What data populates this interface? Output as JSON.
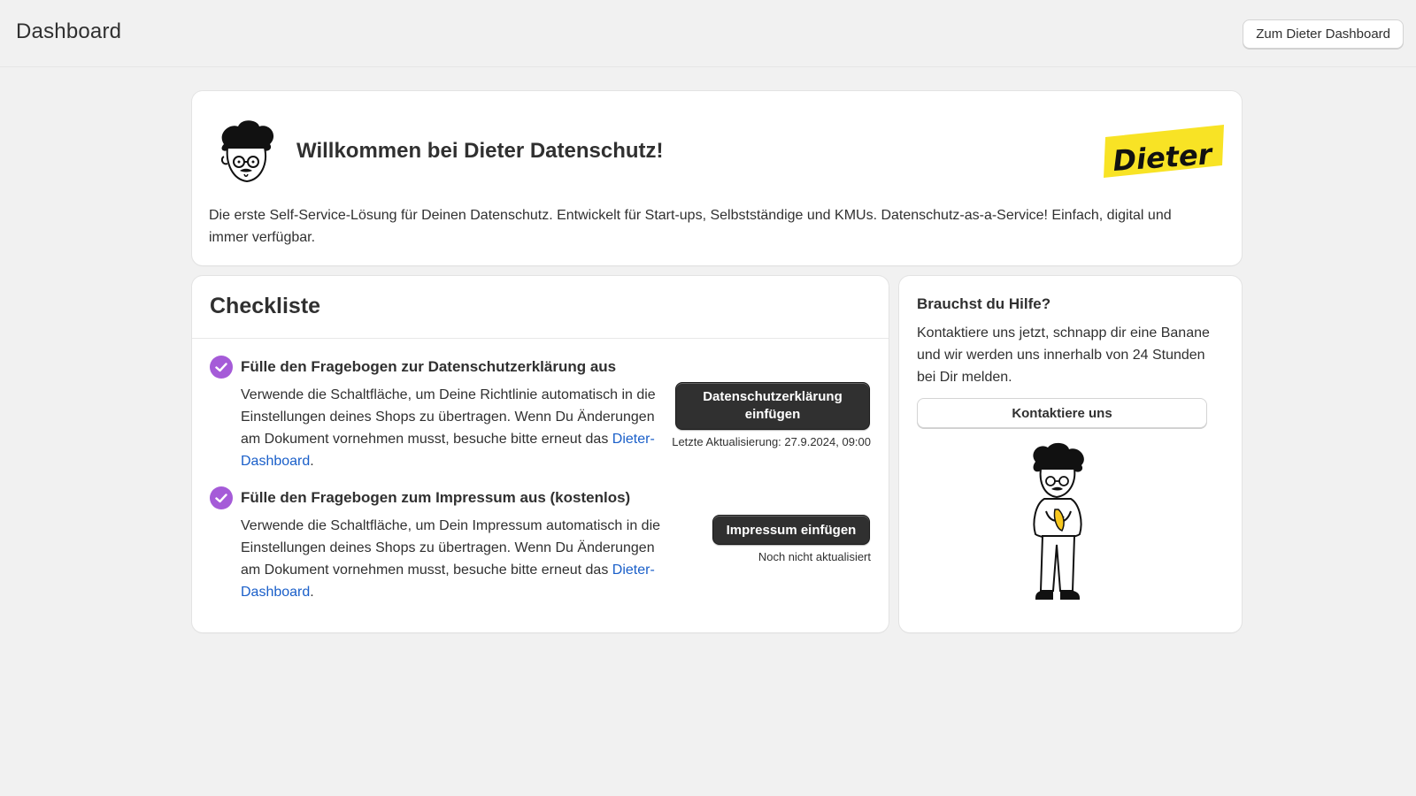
{
  "header": {
    "title": "Dashboard",
    "dashboard_button": "Zum Dieter Dashboard"
  },
  "welcome": {
    "title": "Willkommen bei Dieter Datenschutz!",
    "description": "Die erste Self-Service-Lösung für Deinen Datenschutz. Entwickelt für Start-ups, Selbstständige und KMUs. Datenschutz-as-a-Service! Einfach, digital und immer verfügbar.",
    "logo_text": "Dieter",
    "logo_color": "#f8e325"
  },
  "checklist": {
    "title": "Checkliste",
    "check_color": "#a55bd8",
    "tasks": [
      {
        "title": "Fülle den Fragebogen zur Datenschutzerklärung aus",
        "desc_prefix": "Verwende die Schaltfläche, um Deine Richtlinie automatisch in die Einstellungen deines Shops zu übertragen. Wenn Du Änderungen am Dokument vornehmen musst, besuche bitte erneut das ",
        "link": "Dieter-Dashboard",
        "desc_suffix": ".",
        "button": "Datenschutzerklärung einfügen",
        "status": "Letzte Aktualisierung: 27.9.2024, 09:00",
        "done": true
      },
      {
        "title": "Fülle den Fragebogen zum Impressum aus (kostenlos)",
        "desc_prefix": "Verwende die Schaltfläche, um Dein Impressum automatisch in die Einstellungen deines Shops zu übertragen. Wenn Du Änderungen am Dokument vornehmen musst, besuche bitte erneut das ",
        "link": "Dieter-Dashboard",
        "desc_suffix": ".",
        "button": "Impressum einfügen",
        "status": "Noch nicht aktualisiert",
        "done": true
      }
    ]
  },
  "help": {
    "title": "Brauchst du Hilfe?",
    "description": "Kontaktiere uns jetzt, schnapp dir eine Banane und wir werden uns innerhalb von 24 Stunden bei Dir melden.",
    "button": "Kontaktiere uns"
  }
}
